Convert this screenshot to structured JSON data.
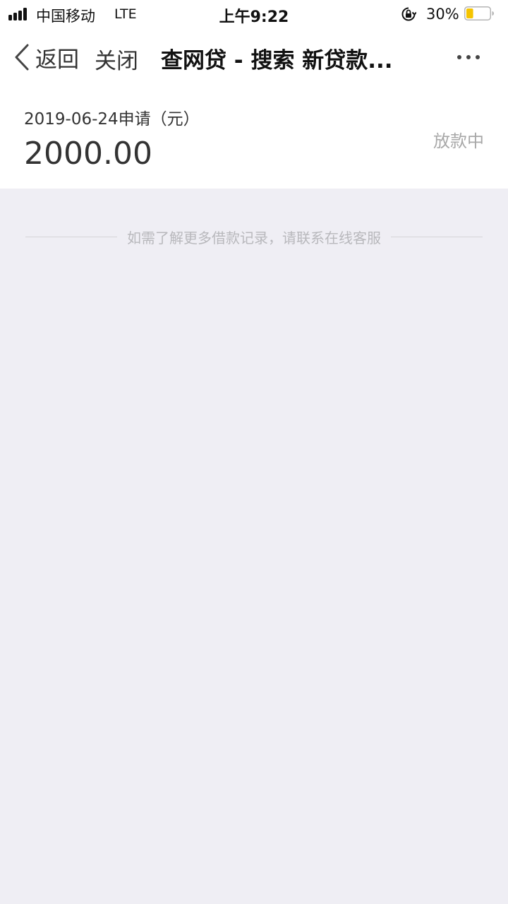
{
  "status_bar": {
    "carrier": "中国移动",
    "network": "LTE",
    "time": "上午9:22",
    "battery_percent": "30%",
    "battery_level": 0.3,
    "battery_color": "#f5c400",
    "icons": [
      "signal-icon",
      "orientation-lock-icon",
      "battery-icon"
    ]
  },
  "nav": {
    "back_label": "返回",
    "close_label": "关闭",
    "title": "查网贷 - 搜索 新贷款...",
    "icons": [
      "chevron-left-icon",
      "more-icon"
    ]
  },
  "loan": {
    "date_label": "2019-06-24申请（元）",
    "amount": "2000.00",
    "status": "放款中"
  },
  "footer": {
    "note": "如需了解更多借款记录，请联系在线客服"
  },
  "colors": {
    "page_background": "#efeef4",
    "card_background": "#ffffff",
    "status_text": "#a8a8a8"
  }
}
